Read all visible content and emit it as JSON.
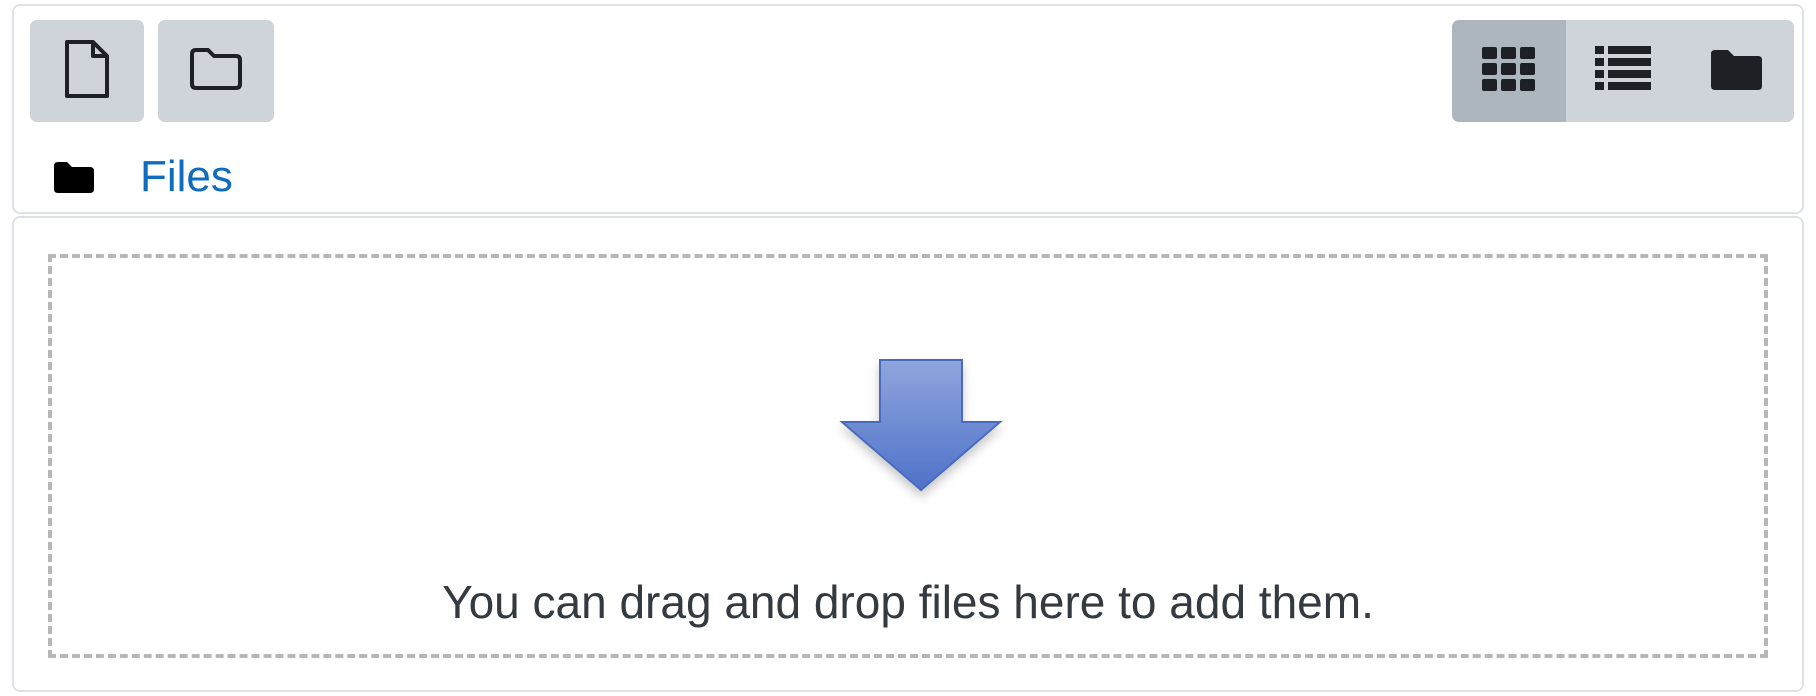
{
  "toolbar": {
    "add_file_icon": "file-icon",
    "create_folder_icon": "folder-outline-icon",
    "views": [
      {
        "icon": "grid-icon",
        "active": true
      },
      {
        "icon": "list-icon",
        "active": false
      },
      {
        "icon": "folder-tree-icon",
        "active": false
      }
    ]
  },
  "path": {
    "icon": "folder-icon",
    "label": "Files"
  },
  "dropzone": {
    "icon": "down-arrow-icon",
    "message": "You can drag and drop files here to add them."
  },
  "colors": {
    "button_bg": "#ced4da",
    "button_active_bg": "#adb5bd",
    "link": "#0f6cbf",
    "arrow": "#5b7fd1",
    "border": "#dee2e6",
    "dash": "#b7b7b7"
  }
}
